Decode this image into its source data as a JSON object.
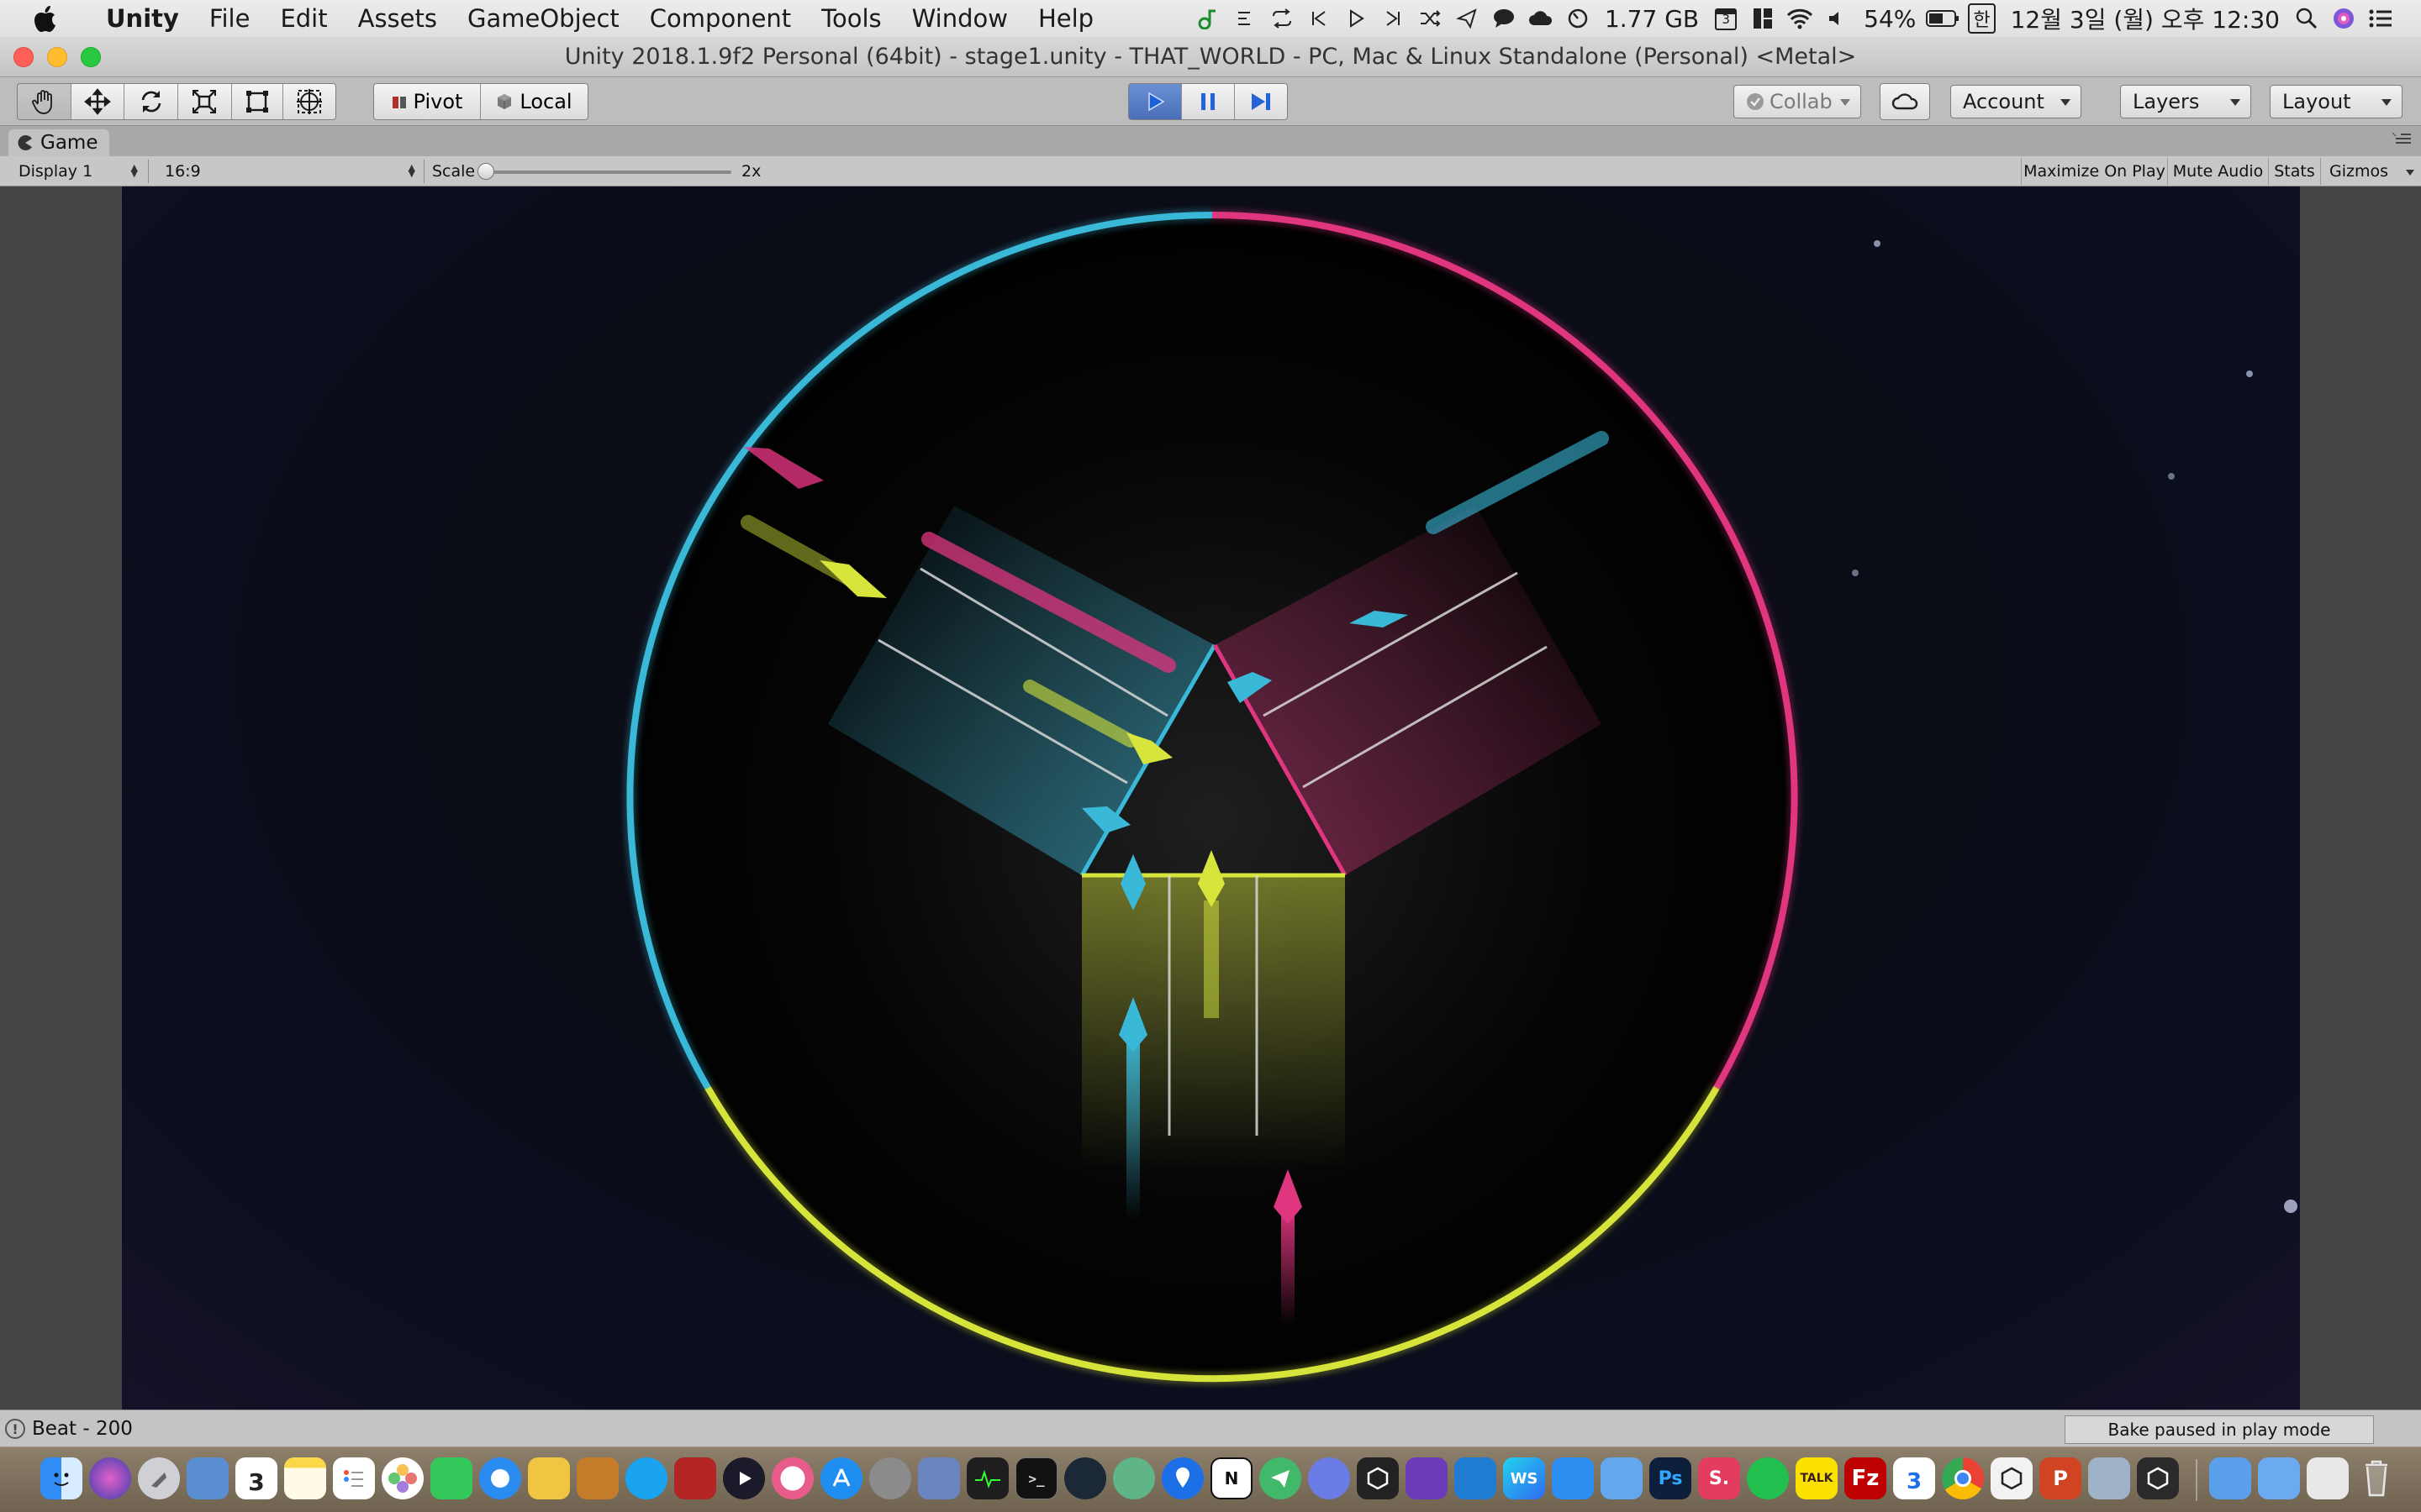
{
  "menubar": {
    "app_name": "Unity",
    "items": [
      "File",
      "Edit",
      "Assets",
      "GameObject",
      "Component",
      "Tools",
      "Window",
      "Help"
    ],
    "memory": "1.77 GB",
    "calendar_day": "3",
    "battery": "54%",
    "input_method": "한",
    "datetime": "12월 3일 (월) 오후 12:30"
  },
  "window": {
    "title": "Unity 2018.1.9f2 Personal (64bit) - stage1.unity - THAT_WORLD - PC, Mac & Linux Standalone (Personal) <Metal>"
  },
  "toolbar": {
    "pivot_label": "Pivot",
    "local_label": "Local",
    "collab_label": "Collab",
    "account_label": "Account",
    "layers_label": "Layers",
    "layout_label": "Layout",
    "play_active": true,
    "accent_color": "#3d6fd1"
  },
  "game_view": {
    "tab_label": "Game",
    "display": "Display 1",
    "aspect": "16:9",
    "scale_label": "Scale",
    "scale_value": "2x",
    "scale_level": 0.0,
    "maximize_on_play": "Maximize On Play",
    "mute_audio": "Mute Audio",
    "stats": "Stats",
    "gizmos": "Gizmos"
  },
  "game_colors": {
    "cyan": "#3ab8d8",
    "magenta": "#e0357f",
    "yellow": "#d6e43b"
  },
  "statusbar": {
    "message": "Beat - 200",
    "bake_status": "Bake paused in play mode"
  },
  "dock": {
    "calendar_day": "3",
    "calendar_day_2": "3"
  }
}
